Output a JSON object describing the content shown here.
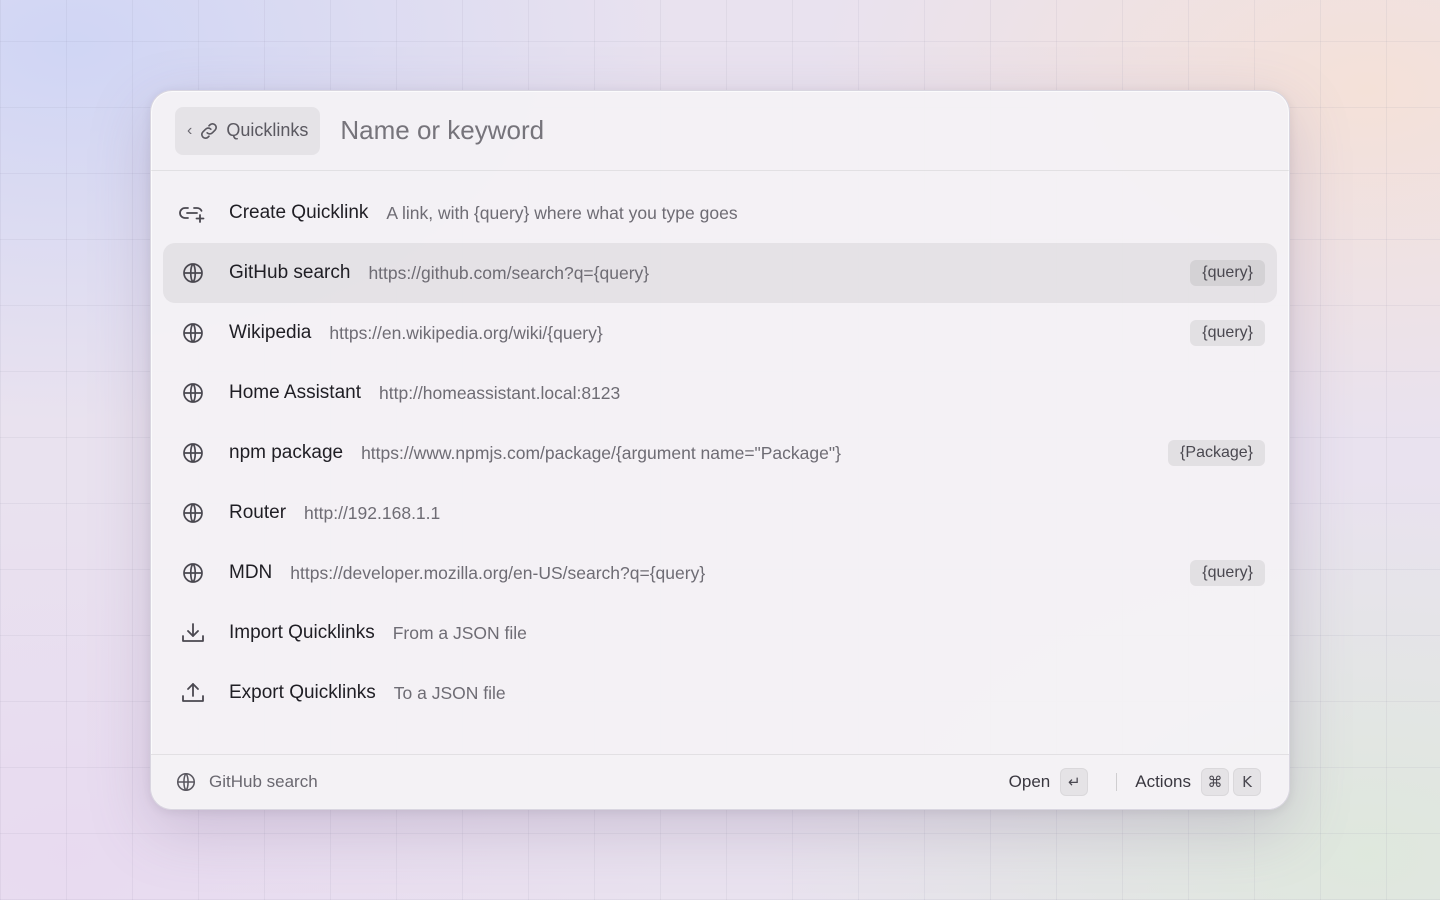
{
  "header": {
    "back_label": "Quicklinks",
    "search_placeholder": "Name or keyword"
  },
  "items": [
    {
      "title": "Create Quicklink",
      "subtitle": "A link, with {query} where what you type goes",
      "icon": "link-plus-icon",
      "accessory": "",
      "selected": false
    },
    {
      "title": "GitHub search",
      "subtitle": "https://github.com/search?q={query}",
      "icon": "globe-icon",
      "accessory": "{query}",
      "selected": true
    },
    {
      "title": "Wikipedia",
      "subtitle": "https://en.wikipedia.org/wiki/{query}",
      "icon": "globe-icon",
      "accessory": "{query}",
      "selected": false
    },
    {
      "title": "Home Assistant",
      "subtitle": "http://homeassistant.local:8123",
      "icon": "globe-icon",
      "accessory": "",
      "selected": false
    },
    {
      "title": "npm package",
      "subtitle": "https://www.npmjs.com/package/{argument name=\"Package\"}",
      "icon": "globe-icon",
      "accessory": "{Package}",
      "selected": false
    },
    {
      "title": "Router",
      "subtitle": "http://192.168.1.1",
      "icon": "globe-icon",
      "accessory": "",
      "selected": false
    },
    {
      "title": "MDN",
      "subtitle": "https://developer.mozilla.org/en-US/search?q={query}",
      "icon": "globe-icon",
      "accessory": "{query}",
      "selected": false
    },
    {
      "title": "Import Quicklinks",
      "subtitle": "From a JSON file",
      "icon": "download-icon",
      "accessory": "",
      "selected": false
    },
    {
      "title": "Export Quicklinks",
      "subtitle": "To a JSON file",
      "icon": "upload-icon",
      "accessory": "",
      "selected": false
    }
  ],
  "footer": {
    "selected_name": "GitHub search",
    "primary_action": "Open",
    "primary_key": "↵",
    "actions_label": "Actions",
    "actions_keys": [
      "⌘",
      "K"
    ]
  }
}
